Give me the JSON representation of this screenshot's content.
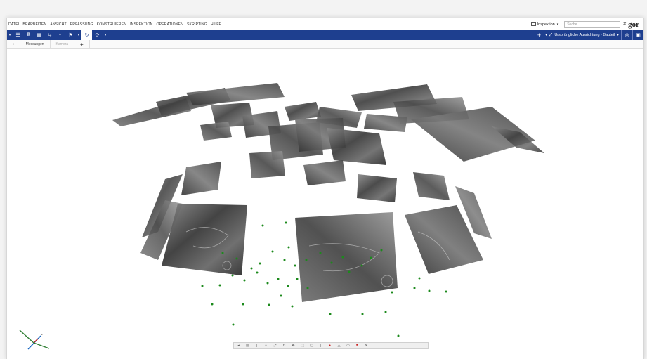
{
  "menu": {
    "items": [
      "DATEI",
      "BEARBEITEN",
      "ANSICHT",
      "ERFASSUNG",
      "KONSTRUIEREN",
      "INSPEKTION",
      "OPERATIONEN",
      "SKRIPTING",
      "HILFE"
    ],
    "workspace_label": "Inspektion",
    "search_placeholder": "Suche",
    "hash_symbol": "#",
    "logo_text": "gor"
  },
  "toolbar": {
    "icons": [
      "menu-icon",
      "table-icon",
      "copy-icon",
      "grid-icon",
      "align-icon",
      "measure-icon",
      "flag-icon",
      "refresh-icon",
      "sync-icon"
    ],
    "alignment_label": "Ursprüngliche Ausrichtung - Bauteil"
  },
  "tabs": [
    {
      "label": "Messungen"
    },
    {
      "label": "Kamera"
    }
  ],
  "tab_add_symbol": "+",
  "viewport": {
    "image_fill": "#555555",
    "point_color": "#1c8a1c",
    "axis_colors": {
      "x": "#2e7d32",
      "y": "#1565c0",
      "z": "#c62828"
    }
  },
  "bottom_icons": [
    "back-icon",
    "view-icon",
    "sep",
    "zoom-icon",
    "fit-icon",
    "rotate-icon",
    "pan-icon",
    "select-icon",
    "lock-icon",
    "sep",
    "alert-icon",
    "warn-icon",
    "note-icon",
    "flag-icon",
    "close-icon"
  ]
}
